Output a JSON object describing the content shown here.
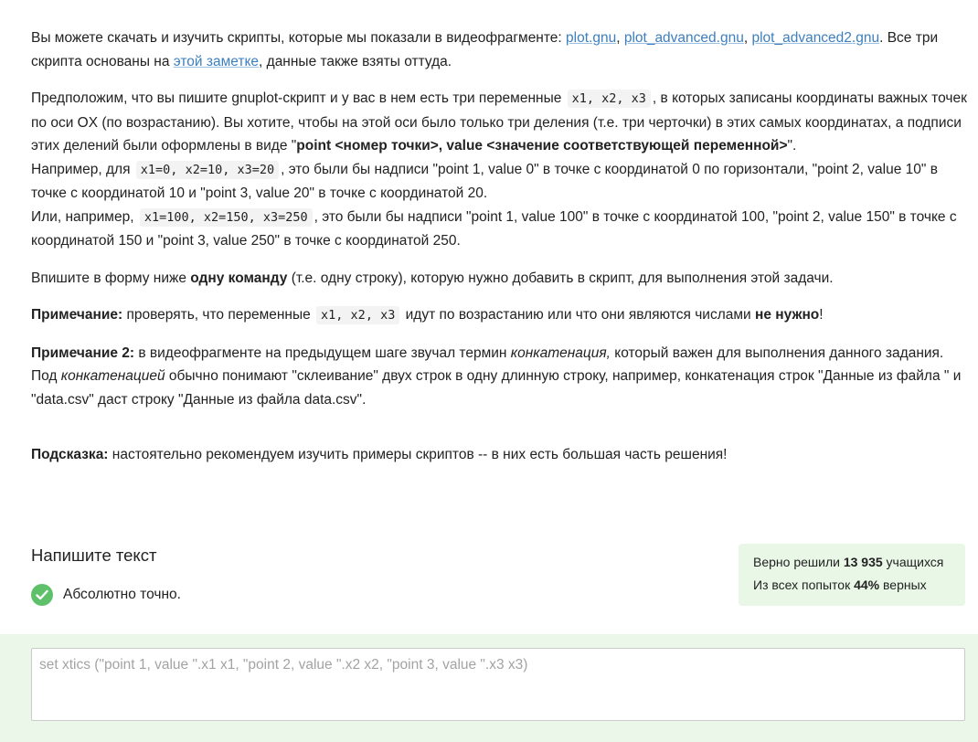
{
  "p1": {
    "t1": "Вы можете скачать и изучить скрипты, которые мы показали в видеофрагменте: ",
    "link1": "plot.gnu",
    "sep1": ", ",
    "link2": "plot_advanced.gnu",
    "sep2": ", ",
    "link3": "plot_advanced2.gnu",
    "t2": ". Все три скрипта основаны на ",
    "link4": "этой заметке",
    "t3": ", данные также взяты оттуда."
  },
  "p2": {
    "t1": "Предположим, что вы пишите gnuplot-скрипт и у вас в нем есть три переменные ",
    "code1": "x1, x2, x3",
    "t2": ", в которых записаны координаты важных точек по оси OX (по возрастанию). Вы хотите, чтобы на этой оси было только три деления (т.е. три черточки) в этих самых координатах, а подписи этих делений были оформлены в виде \"",
    "b1": "point <номер точки>, value <значение соответствующей переменной>",
    "t3": "\".",
    "t4": "Например, для ",
    "code2": "x1=0, x2=10, x3=20",
    "t5": ", это были бы надписи \"point 1, value 0\" в точке с координатой 0 по горизонтали,  \"point 2, value 10\" в точке с координатой 10 и  \"point 3, value 20\" в точке с координатой 20.",
    "t6": "Или, например, ",
    "code3": "x1=100, x2=150, x3=250",
    "t7": ", это были бы надписи \"point 1, value 100\" в точке с координатой 100, \"point 2, value 150\" в точке с координатой 150 и \"point 3, value 250\" в точке с координатой 250."
  },
  "p3": {
    "t1": "Впишите в форму ниже ",
    "b1": "одну команду",
    "t2": " (т.е. одну строку), которую нужно добавить в скрипт, для выполнения этой задачи."
  },
  "p4": {
    "b1": "Примечание:",
    "t1": " проверять, что переменные ",
    "code1": "x1, x2, x3",
    "t2": " идут по возрастанию или что они являются числами ",
    "b2": "не нужно",
    "t3": "!"
  },
  "p5": {
    "b1": "Примечание 2:",
    "t1": " в видеофрагменте на предыдущем шаге звучал термин ",
    "i1": "конкатенация,",
    "t2": " который важен для выполнения данного задания. Под ",
    "i2": "конкатенацией",
    "t3": " обычно понимают \"склеивание\" двух строк в одну длинную строку, например, конкатенация строк \"Данные из файла \" и \"data.csv\" даст строку \"Данные из файла data.csv\"."
  },
  "p6": {
    "b1": "Подсказка:",
    "t1": " настоятельно рекомендуем изучить примеры скриптов -- в них есть большая часть решения!"
  },
  "answer": {
    "title": "Напишите текст",
    "result": "Абсолютно точно.",
    "value": "set xtics (\"point 1, value \".x1 x1, \"point 2, value \".x2 x2, \"point 3, value \".x3 x3)"
  },
  "stats": {
    "solved_prefix": "Верно решили ",
    "solved_count": "13 935",
    "solved_suffix": " учащихся",
    "attempts_prefix": "Из всех попыток ",
    "attempts_percent": "44%",
    "attempts_suffix": " верных"
  },
  "colors": {
    "link": "#3d7fbf",
    "success": "#5ec16a",
    "answer_bg": "#eaf7e9"
  }
}
